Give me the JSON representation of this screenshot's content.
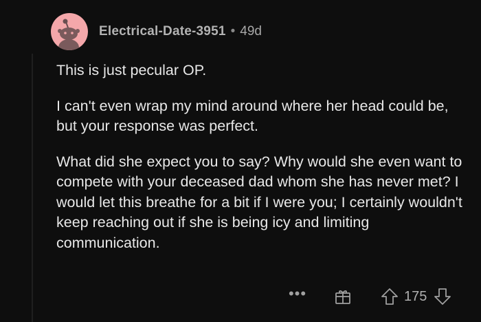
{
  "comment": {
    "username": "Electrical-Date-3951",
    "separator": "•",
    "age": "49d",
    "paragraphs": [
      "This is just pecular OP.",
      "I can't even wrap my mind around where her head could be, but your response was perfect.",
      "What did she expect you to say? Why would she even want to compete with your deceased dad whom she has never met? I would let this breathe for a bit if I were you; I certainly wouldn't keep reaching out if she is being icy and limiting communication."
    ]
  },
  "actions": {
    "more_label": "•••",
    "vote_count": "175"
  },
  "icons": {
    "avatar": "snoo-avatar-icon",
    "more": "ellipsis-icon",
    "award": "gift-icon",
    "upvote": "arrow-up-icon",
    "downvote": "arrow-down-icon"
  },
  "colors": {
    "background": "#0e0e0e",
    "avatar_bg": "#f4a7aa",
    "text": "#e8e8e8",
    "muted": "#a8a8a8"
  }
}
